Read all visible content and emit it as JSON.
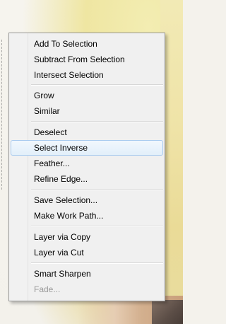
{
  "context_menu": {
    "groups": [
      {
        "items": [
          {
            "label": "Add To Selection"
          },
          {
            "label": "Subtract From Selection"
          },
          {
            "label": "Intersect Selection"
          }
        ]
      },
      {
        "items": [
          {
            "label": "Grow"
          },
          {
            "label": "Similar"
          }
        ]
      },
      {
        "items": [
          {
            "label": "Deselect"
          },
          {
            "label": "Select Inverse",
            "highlighted": true
          },
          {
            "label": "Feather..."
          },
          {
            "label": "Refine Edge..."
          }
        ]
      },
      {
        "items": [
          {
            "label": "Save Selection..."
          },
          {
            "label": "Make Work Path..."
          }
        ]
      },
      {
        "items": [
          {
            "label": "Layer via Copy"
          },
          {
            "label": "Layer via Cut"
          }
        ]
      },
      {
        "items": [
          {
            "label": "Smart Sharpen"
          },
          {
            "label": "Fade...",
            "disabled": true
          }
        ]
      }
    ]
  }
}
